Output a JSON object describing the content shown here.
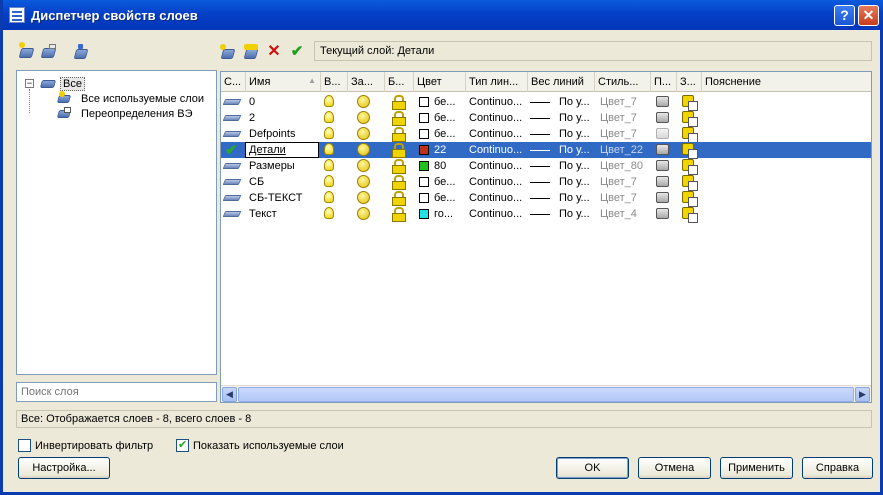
{
  "window": {
    "title": "Диспетчер свойств слоев",
    "help_label": "?",
    "close_label": "✕"
  },
  "toolbar": {
    "current_layer_label": "Текущий слой: Детали"
  },
  "tree": {
    "root": "Все",
    "children": [
      "Все используемые слои",
      "Переопределения ВЭ"
    ],
    "expander": "−"
  },
  "search": {
    "placeholder": "Поиск слоя"
  },
  "grid": {
    "columns": [
      "С...",
      "Имя",
      "В...",
      "За...",
      "Б...",
      "Цвет",
      "Тип лин...",
      "Вес линий",
      "Стиль...",
      "П...",
      "З...",
      "Пояснение"
    ],
    "sort_indicator": "▲",
    "rows": [
      {
        "name": "0",
        "color_name": "бе...",
        "color_hex": "#ffffff",
        "linetype": "Continuo...",
        "lineweight": "По у...",
        "plotstyle": "Цвет_7",
        "plot": true,
        "current": false
      },
      {
        "name": "2",
        "color_name": "бе...",
        "color_hex": "#ffffff",
        "linetype": "Continuo...",
        "lineweight": "По у...",
        "plotstyle": "Цвет_7",
        "plot": true,
        "current": false
      },
      {
        "name": "Defpoints",
        "color_name": "бе...",
        "color_hex": "#ffffff",
        "linetype": "Continuo...",
        "lineweight": "По у...",
        "plotstyle": "Цвет_7",
        "plot": false,
        "current": false
      },
      {
        "name": "Детали",
        "color_name": "22",
        "color_hex": "#c0301a",
        "linetype": "Continuo...",
        "lineweight": "По у...",
        "plotstyle": "Цвет_22",
        "plot": true,
        "current": true
      },
      {
        "name": "Размеры",
        "color_name": "80",
        "color_hex": "#22c020",
        "linetype": "Continuo...",
        "lineweight": "По у...",
        "plotstyle": "Цвет_80",
        "plot": true,
        "current": false
      },
      {
        "name": "СБ",
        "color_name": "бе...",
        "color_hex": "#ffffff",
        "linetype": "Continuo...",
        "lineweight": "По у...",
        "plotstyle": "Цвет_7",
        "plot": true,
        "current": false
      },
      {
        "name": "СБ-ТЕКСТ",
        "color_name": "бе...",
        "color_hex": "#ffffff",
        "linetype": "Continuo...",
        "lineweight": "По у...",
        "plotstyle": "Цвет_7",
        "plot": true,
        "current": false
      },
      {
        "name": "Текст",
        "color_name": "го...",
        "color_hex": "#20e0e8",
        "linetype": "Continuo...",
        "lineweight": "По у...",
        "plotstyle": "Цвет_4",
        "plot": true,
        "current": false
      }
    ],
    "current_mark": "✔",
    "scroll_left": "◀",
    "scroll_right": "▶"
  },
  "status": {
    "text": "Все: Отображается слоев - 8, всего слоев - 8"
  },
  "options": {
    "invert_filter_label": "Инвертировать фильтр",
    "invert_filter_checked": false,
    "show_used_label": "Показать используемые слои",
    "show_used_checked": true
  },
  "buttons": {
    "settings": "Настройка...",
    "ok": "OK",
    "cancel": "Отмена",
    "apply": "Применить",
    "help": "Справка"
  },
  "colors": {
    "titlebar": "#0540c8",
    "selection": "#316ac5",
    "dialog_bg": "#ece9d8"
  }
}
